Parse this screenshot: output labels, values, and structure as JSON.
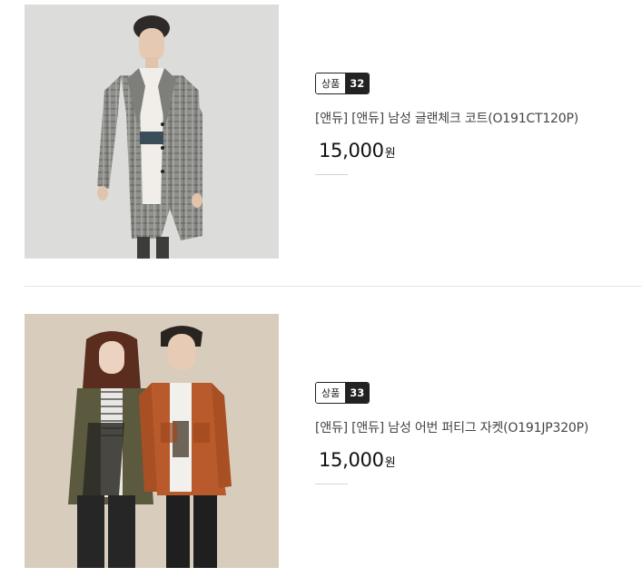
{
  "products": [
    {
      "badge_label": "상품",
      "badge_number": "32",
      "name": "[앤듀] [앤듀] 남성 글랜체크 코트(O191CT120P)",
      "price": "15,000",
      "currency": "원"
    },
    {
      "badge_label": "상품",
      "badge_number": "33",
      "name": "[앤듀] [앤듀] 남성 어번 퍼티그 자켓(O191JP320P)",
      "price": "15,000",
      "currency": "원"
    }
  ]
}
